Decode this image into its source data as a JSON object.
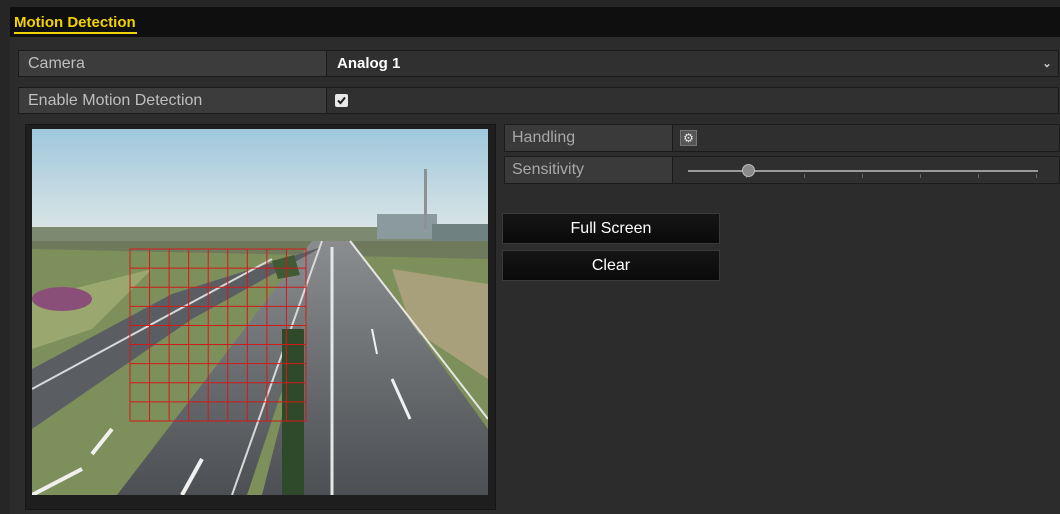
{
  "header": {
    "title": "Motion Detection"
  },
  "settings": {
    "camera": {
      "label": "Camera",
      "value": "Analog 1",
      "dropdown_icon": "chevron-down-icon"
    },
    "enable": {
      "label": "Enable Motion Detection",
      "checked": true
    }
  },
  "panel": {
    "handling": {
      "label": "Handling",
      "icon": "gear-icon"
    },
    "sensitivity": {
      "label": "Sensitivity",
      "level": 0.17
    }
  },
  "buttons": {
    "full_screen": "Full Screen",
    "clear": "Clear"
  },
  "colors": {
    "title": "#f2d300",
    "grid": "#d11a1a",
    "background": "#262626"
  }
}
